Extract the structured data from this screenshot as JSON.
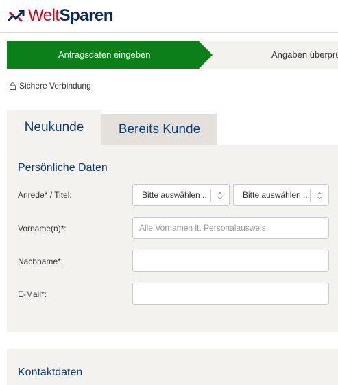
{
  "brand": {
    "name_part1": "Welt",
    "name_part2": "Sparen"
  },
  "steps": {
    "active_label": "Antragsdaten eingeben",
    "next_label": "Angaben überprü"
  },
  "secure": {
    "label": "Sichere Verbindung"
  },
  "tabs": [
    {
      "label": "Neukunde",
      "active": true
    },
    {
      "label": "Bereits Kunde",
      "active": false
    }
  ],
  "personal": {
    "title": "Persönliche Daten",
    "salutation": {
      "label": "Anrede* / Titel:",
      "anrede_selected": "Bitte auswählen ...",
      "titel_selected": "Bitte auswählen ..."
    },
    "firstname": {
      "label": "Vorname(n)*:",
      "value": "",
      "placeholder": "Alle Vornamen lt. Personalausweis"
    },
    "lastname": {
      "label": "Nachname*:",
      "value": "",
      "placeholder": ""
    },
    "email": {
      "label": "E-Mail*:",
      "value": "",
      "placeholder": ""
    }
  },
  "contact": {
    "title": "Kontaktdaten"
  },
  "colors": {
    "accent_green": "#0b7f18",
    "brand_blue": "#0a3a78",
    "brand_red": "#e2001a",
    "panel_bg": "#f4f2ef"
  }
}
